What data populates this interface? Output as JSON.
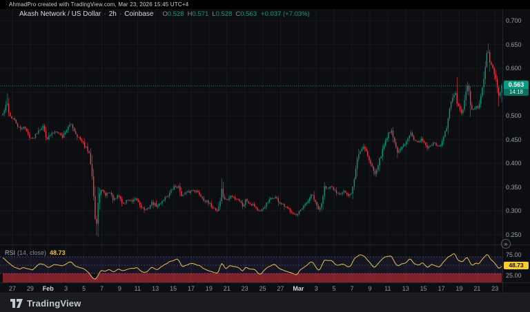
{
  "attribution": {
    "text": "AhmadPro created with TradingView.com, Mar 23, 2026 15:45 UTC+4"
  },
  "legend": {
    "title": "Akash Network / US Dollar",
    "separator": "·",
    "interval": "2h",
    "exchange": "Coinbase",
    "ohlc": [
      {
        "label": "O",
        "value": "0.528"
      },
      {
        "label": "H",
        "value": "0.571"
      },
      {
        "label": "L",
        "value": "0.528"
      },
      {
        "label": "C",
        "value": "0.563"
      }
    ],
    "change": "+0.037 (+7.03%)"
  },
  "price_axis": {
    "labels": [
      "0.700",
      "0.650",
      "0.600",
      "0.500",
      "0.450",
      "0.400",
      "0.350",
      "0.300",
      "0.250"
    ],
    "badge": {
      "price": "0.563",
      "countdown": "14:18"
    }
  },
  "rsi": {
    "label": "RSI",
    "params": "(14, close)",
    "value": "48.73",
    "axis_labels": [
      "75.00",
      "25.00"
    ]
  },
  "footer": {
    "logo_text": "TradingView"
  },
  "scroll_button": {
    "glyph": "»"
  },
  "colors": {
    "up": "#089981",
    "down": "#f23645",
    "rsi_line": "#e8c24a",
    "rsi_badge": "#f8cb2e",
    "band": "#7d62d9",
    "background": "#0d0e12",
    "footer_bg": "#1b1c20",
    "axis_text": "#9aa0aa",
    "grid": "rgba(255,255,255,0.05)"
  },
  "chart_data": {
    "type": "candlestick",
    "symbol": "AKT/USD",
    "title": "Akash Network / US Dollar",
    "interval": "2h",
    "exchange": "Coinbase",
    "ylim": [
      0.234,
      0.715
    ],
    "y_ticks": [
      0.7,
      0.65,
      0.6,
      0.55,
      0.5,
      0.45,
      0.4,
      0.35,
      0.3,
      0.25
    ],
    "x_axis": {
      "labels": [
        "27",
        "29",
        "Feb",
        "3",
        "5",
        "7",
        "9",
        "11",
        "13",
        "15",
        "17",
        "19",
        "21",
        "23",
        "25",
        "27",
        "Mar",
        "3",
        "5",
        "7",
        "9",
        "11",
        "13",
        "15",
        "17",
        "19",
        "21",
        "23"
      ],
      "start": "Jan 27",
      "end": "Mar 23"
    },
    "last": {
      "open": 0.528,
      "high": 0.571,
      "low": 0.528,
      "close": 0.563,
      "change": 0.037,
      "change_pct": 7.03
    },
    "price_points": [
      [
        3,
        0.5
      ],
      [
        7,
        0.515
      ],
      [
        10,
        0.528
      ],
      [
        14,
        0.5
      ],
      [
        20,
        0.492
      ],
      [
        26,
        0.478
      ],
      [
        30,
        0.47
      ],
      [
        34,
        0.48
      ],
      [
        40,
        0.462
      ],
      [
        47,
        0.451
      ],
      [
        55,
        0.47
      ],
      [
        62,
        0.478
      ],
      [
        68,
        0.452
      ],
      [
        75,
        0.462
      ],
      [
        82,
        0.47
      ],
      [
        90,
        0.455
      ],
      [
        96,
        0.47
      ],
      [
        103,
        0.483
      ],
      [
        110,
        0.462
      ],
      [
        118,
        0.446
      ],
      [
        125,
        0.432
      ],
      [
        130,
        0.416
      ],
      [
        134,
        0.37
      ],
      [
        137,
        0.305
      ],
      [
        139,
        0.253
      ],
      [
        142,
        0.315
      ],
      [
        146,
        0.348
      ],
      [
        152,
        0.332
      ],
      [
        158,
        0.342
      ],
      [
        165,
        0.322
      ],
      [
        172,
        0.332
      ],
      [
        178,
        0.314
      ],
      [
        185,
        0.324
      ],
      [
        192,
        0.318
      ],
      [
        197,
        0.325
      ],
      [
        203,
        0.313
      ],
      [
        208,
        0.304
      ],
      [
        212,
        0.3
      ],
      [
        220,
        0.317
      ],
      [
        228,
        0.309
      ],
      [
        236,
        0.323
      ],
      [
        244,
        0.334
      ],
      [
        252,
        0.35
      ],
      [
        258,
        0.352
      ],
      [
        264,
        0.331
      ],
      [
        270,
        0.338
      ],
      [
        276,
        0.341
      ],
      [
        280,
        0.346
      ],
      [
        288,
        0.337
      ],
      [
        296,
        0.323
      ],
      [
        303,
        0.314
      ],
      [
        310,
        0.306
      ],
      [
        315,
        0.3
      ],
      [
        319,
        0.32
      ],
      [
        321,
        0.347
      ],
      [
        323,
        0.331
      ],
      [
        328,
        0.321
      ],
      [
        334,
        0.331
      ],
      [
        340,
        0.327
      ],
      [
        346,
        0.325
      ],
      [
        352,
        0.31
      ],
      [
        356,
        0.324
      ],
      [
        362,
        0.316
      ],
      [
        368,
        0.313
      ],
      [
        372,
        0.304
      ],
      [
        377,
        0.296
      ],
      [
        384,
        0.311
      ],
      [
        390,
        0.321
      ],
      [
        395,
        0.327
      ],
      [
        398,
        0.33
      ],
      [
        404,
        0.319
      ],
      [
        410,
        0.311
      ],
      [
        416,
        0.304
      ],
      [
        422,
        0.301
      ],
      [
        427,
        0.293
      ],
      [
        430,
        0.289
      ],
      [
        436,
        0.301
      ],
      [
        444,
        0.316
      ],
      [
        450,
        0.331
      ],
      [
        453,
        0.332
      ],
      [
        458,
        0.313
      ],
      [
        463,
        0.3
      ],
      [
        468,
        0.332
      ],
      [
        470,
        0.356
      ],
      [
        474,
        0.346
      ],
      [
        480,
        0.349
      ],
      [
        486,
        0.341
      ],
      [
        492,
        0.337
      ],
      [
        498,
        0.343
      ],
      [
        505,
        0.329
      ],
      [
        510,
        0.341
      ],
      [
        514,
        0.372
      ],
      [
        517,
        0.406
      ],
      [
        520,
        0.421
      ],
      [
        524,
        0.431
      ],
      [
        527,
        0.438
      ],
      [
        532,
        0.421
      ],
      [
        536,
        0.401
      ],
      [
        540,
        0.391
      ],
      [
        543,
        0.378
      ],
      [
        548,
        0.399
      ],
      [
        553,
        0.421
      ],
      [
        558,
        0.446
      ],
      [
        563,
        0.463
      ],
      [
        567,
        0.472
      ],
      [
        572,
        0.441
      ],
      [
        577,
        0.421
      ],
      [
        582,
        0.433
      ],
      [
        588,
        0.441
      ],
      [
        592,
        0.456
      ],
      [
        595,
        0.469
      ],
      [
        600,
        0.451
      ],
      [
        606,
        0.443
      ],
      [
        612,
        0.451
      ],
      [
        617,
        0.439
      ],
      [
        620,
        0.431
      ],
      [
        626,
        0.441
      ],
      [
        632,
        0.439
      ],
      [
        638,
        0.433
      ],
      [
        643,
        0.456
      ],
      [
        647,
        0.474
      ],
      [
        650,
        0.501
      ],
      [
        653,
        0.527
      ],
      [
        657,
        0.541
      ],
      [
        660,
        0.549
      ],
      [
        662,
        0.523
      ],
      [
        666,
        0.513
      ],
      [
        670,
        0.504
      ],
      [
        674,
        0.541
      ],
      [
        677,
        0.561
      ],
      [
        678,
        0.568
      ],
      [
        681,
        0.531
      ],
      [
        683,
        0.509
      ],
      [
        687,
        0.516
      ],
      [
        690,
        0.521
      ],
      [
        693,
        0.513
      ],
      [
        697,
        0.541
      ],
      [
        700,
        0.568
      ],
      [
        703,
        0.601
      ],
      [
        705,
        0.626
      ],
      [
        707,
        0.641
      ],
      [
        709,
        0.616
      ],
      [
        712,
        0.606
      ],
      [
        714,
        0.599
      ],
      [
        717,
        0.581
      ],
      [
        720,
        0.571
      ],
      [
        722,
        0.538
      ],
      [
        725,
        0.546
      ],
      [
        727,
        0.563
      ]
    ],
    "wick_events": [
      [
        10,
        "high",
        0.548
      ],
      [
        139,
        "low",
        0.248
      ],
      [
        321,
        "high",
        0.366
      ],
      [
        662,
        "high",
        0.582
      ],
      [
        678,
        "high",
        0.572
      ],
      [
        707,
        "high",
        0.652
      ],
      [
        722,
        "low",
        0.52
      ],
      [
        727,
        "low",
        0.528
      ]
    ],
    "indicator": {
      "type": "line",
      "name": "RSI",
      "period": 14,
      "source": "close",
      "value": 48.73,
      "overbought": 70,
      "middle": 50,
      "oversold": 30,
      "axis_ticks": [
        75,
        25
      ],
      "points": [
        [
          3,
          70
        ],
        [
          7,
          64
        ],
        [
          10,
          60
        ],
        [
          14,
          52
        ],
        [
          20,
          47
        ],
        [
          26,
          42
        ],
        [
          30,
          40
        ],
        [
          34,
          46
        ],
        [
          40,
          42
        ],
        [
          47,
          38
        ],
        [
          55,
          50
        ],
        [
          62,
          55
        ],
        [
          68,
          44
        ],
        [
          75,
          49
        ],
        [
          82,
          53
        ],
        [
          90,
          46
        ],
        [
          96,
          52
        ],
        [
          103,
          58
        ],
        [
          110,
          48
        ],
        [
          118,
          42
        ],
        [
          125,
          36
        ],
        [
          130,
          30
        ],
        [
          134,
          20
        ],
        [
          139,
          12
        ],
        [
          142,
          24
        ],
        [
          146,
          37
        ],
        [
          152,
          32
        ],
        [
          158,
          40
        ],
        [
          165,
          34
        ],
        [
          172,
          42
        ],
        [
          178,
          35
        ],
        [
          185,
          43
        ],
        [
          192,
          40
        ],
        [
          197,
          45
        ],
        [
          203,
          38
        ],
        [
          208,
          33
        ],
        [
          212,
          30
        ],
        [
          220,
          45
        ],
        [
          228,
          39
        ],
        [
          236,
          49
        ],
        [
          244,
          55
        ],
        [
          252,
          63
        ],
        [
          258,
          65
        ],
        [
          264,
          46
        ],
        [
          270,
          51
        ],
        [
          276,
          53
        ],
        [
          280,
          57
        ],
        [
          288,
          49
        ],
        [
          296,
          41
        ],
        [
          303,
          37
        ],
        [
          310,
          32
        ],
        [
          315,
          28
        ],
        [
          319,
          45
        ],
        [
          321,
          60
        ],
        [
          323,
          50
        ],
        [
          328,
          41
        ],
        [
          334,
          50
        ],
        [
          340,
          47
        ],
        [
          346,
          45
        ],
        [
          352,
          34
        ],
        [
          356,
          47
        ],
        [
          362,
          42
        ],
        [
          368,
          40
        ],
        [
          372,
          33
        ],
        [
          377,
          26
        ],
        [
          384,
          40
        ],
        [
          390,
          46
        ],
        [
          395,
          51
        ],
        [
          398,
          53
        ],
        [
          404,
          43
        ],
        [
          410,
          39
        ],
        [
          416,
          35
        ],
        [
          422,
          33
        ],
        [
          427,
          28
        ],
        [
          430,
          26
        ],
        [
          436,
          40
        ],
        [
          444,
          50
        ],
        [
          450,
          58
        ],
        [
          453,
          59
        ],
        [
          458,
          43
        ],
        [
          463,
          34
        ],
        [
          468,
          56
        ],
        [
          470,
          66
        ],
        [
          474,
          58
        ],
        [
          480,
          61
        ],
        [
          486,
          53
        ],
        [
          492,
          49
        ],
        [
          498,
          54
        ],
        [
          505,
          43
        ],
        [
          510,
          52
        ],
        [
          514,
          66
        ],
        [
          517,
          72
        ],
        [
          520,
          74
        ],
        [
          524,
          75
        ],
        [
          527,
          76
        ],
        [
          532,
          64
        ],
        [
          536,
          54
        ],
        [
          540,
          48
        ],
        [
          543,
          42
        ],
        [
          548,
          55
        ],
        [
          553,
          63
        ],
        [
          558,
          69
        ],
        [
          563,
          73
        ],
        [
          567,
          75
        ],
        [
          572,
          55
        ],
        [
          577,
          45
        ],
        [
          582,
          53
        ],
        [
          588,
          57
        ],
        [
          592,
          64
        ],
        [
          595,
          68
        ],
        [
          600,
          55
        ],
        [
          606,
          50
        ],
        [
          612,
          56
        ],
        [
          617,
          48
        ],
        [
          620,
          44
        ],
        [
          626,
          53
        ],
        [
          632,
          50
        ],
        [
          638,
          45
        ],
        [
          643,
          60
        ],
        [
          647,
          66
        ],
        [
          650,
          71
        ],
        [
          653,
          75
        ],
        [
          657,
          77
        ],
        [
          660,
          78
        ],
        [
          662,
          66
        ],
        [
          666,
          60
        ],
        [
          670,
          54
        ],
        [
          674,
          66
        ],
        [
          677,
          71
        ],
        [
          678,
          72
        ],
        [
          681,
          55
        ],
        [
          683,
          47
        ],
        [
          687,
          52
        ],
        [
          690,
          55
        ],
        [
          693,
          50
        ],
        [
          697,
          61
        ],
        [
          700,
          67
        ],
        [
          703,
          73
        ],
        [
          705,
          76
        ],
        [
          707,
          78
        ],
        [
          709,
          66
        ],
        [
          712,
          62
        ],
        [
          714,
          60
        ],
        [
          717,
          54
        ],
        [
          720,
          50
        ],
        [
          722,
          40
        ],
        [
          725,
          44
        ],
        [
          727,
          48.73
        ]
      ]
    }
  }
}
